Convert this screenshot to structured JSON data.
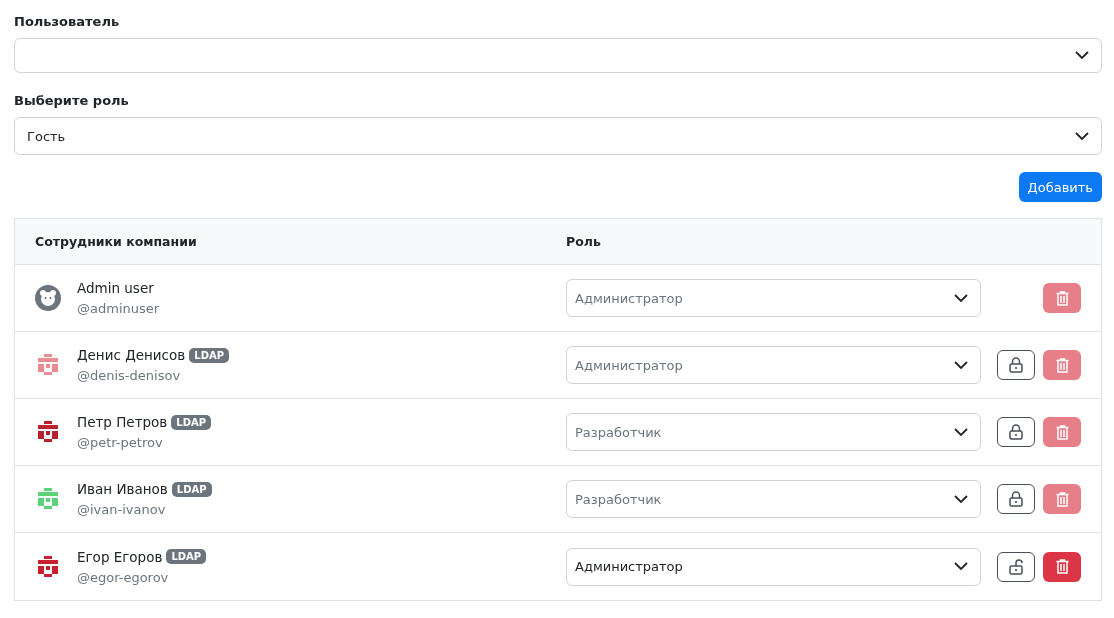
{
  "user_field": {
    "label": "Пользователь"
  },
  "role_field": {
    "label": "Выберите роль",
    "value": "Гость"
  },
  "add_button": "Добавить",
  "table": {
    "columns": [
      "Сотрудники компании",
      "Роль"
    ],
    "rows": [
      {
        "name": "Admin user",
        "username": "@adminuser",
        "avatar": {
          "kind": "default",
          "color": "#6c757d"
        },
        "role": "Администратор",
        "role_disabled": true,
        "lock_button": false,
        "delete_disabled": true
      },
      {
        "name": "Денис Денисов",
        "badge": "LDAP",
        "username": "@denis-denisov",
        "avatar": {
          "kind": "identicon",
          "color": "#ec8b92"
        },
        "role": "Администратор",
        "role_disabled": true,
        "lock_button": true,
        "locked": true,
        "delete_disabled": true
      },
      {
        "name": "Петр Петров",
        "badge": "LDAP",
        "username": "@petr-petrov",
        "avatar": {
          "kind": "identicon",
          "color": "#b8202f"
        },
        "role": "Разработчик",
        "role_disabled": true,
        "lock_button": true,
        "locked": true,
        "delete_disabled": true
      },
      {
        "name": "Иван Иванов",
        "badge": "LDAP",
        "username": "@ivan-ivanov",
        "avatar": {
          "kind": "identicon",
          "color": "#5cd276"
        },
        "role": "Разработчик",
        "role_disabled": true,
        "lock_button": true,
        "locked": true,
        "delete_disabled": true
      },
      {
        "name": "Егор Егоров",
        "badge": "LDAP",
        "username": "@egor-egorov",
        "avatar": {
          "kind": "identicon",
          "color": "#c8202f"
        },
        "role": "Администратор",
        "role_disabled": false,
        "lock_button": true,
        "locked": false,
        "delete_disabled": false
      }
    ]
  }
}
